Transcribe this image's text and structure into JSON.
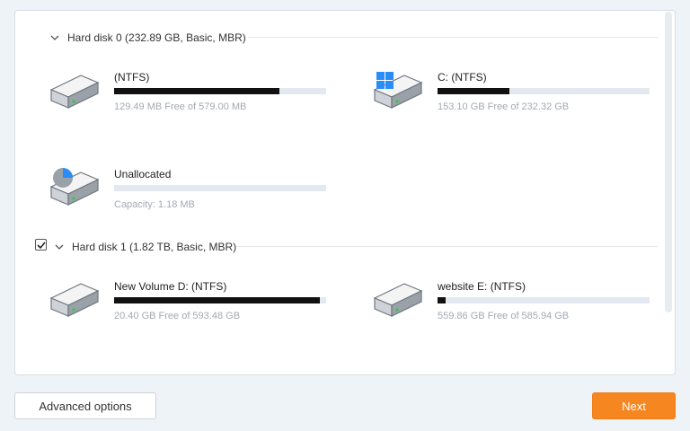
{
  "disk0": {
    "title": "Hard disk 0 (232.89 GB, Basic, MBR)",
    "partitions": [
      {
        "label": " (NTFS)",
        "sub": "129.49 MB Free of 579.00 MB",
        "used_fraction": 0.78,
        "icon": "hard-drive-icon"
      },
      {
        "label": "C: (NTFS)",
        "sub": "153.10 GB Free of 232.32 GB",
        "used_fraction": 0.34,
        "icon": "windows-drive-icon"
      },
      {
        "label": "Unallocated",
        "sub": "Capacity: 1.18 MB",
        "used_fraction": 0.0,
        "icon": "unallocated-drive-icon"
      }
    ]
  },
  "disk1": {
    "title": "Hard disk 1 (1.82 TB, Basic, MBR)",
    "checked": true,
    "partitions": [
      {
        "label": "New Volume D: (NTFS)",
        "sub": "20.40 GB Free of 593.48 GB",
        "used_fraction": 0.97,
        "icon": "hard-drive-icon"
      },
      {
        "label": "website E: (NTFS)",
        "sub": "559.86 GB Free of 585.94 GB",
        "used_fraction": 0.04,
        "icon": "hard-drive-icon"
      }
    ]
  },
  "footer": {
    "advanced_label": "Advanced options",
    "next_label": "Next"
  },
  "colors": {
    "accent": "#f6861f",
    "bar_fill": "#111111",
    "bar_track": "#e4e9f1",
    "win_blue": "#2a8df5"
  }
}
